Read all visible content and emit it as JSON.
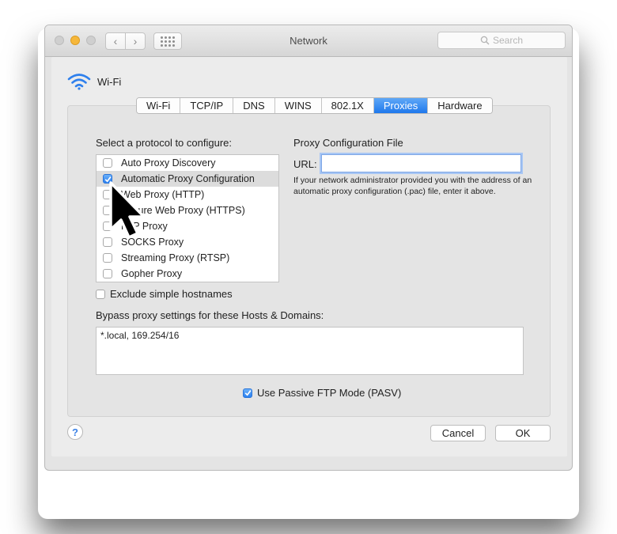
{
  "window": {
    "title": "Network",
    "search_placeholder": "Search"
  },
  "header": {
    "title": "Wi-Fi"
  },
  "tabs": [
    {
      "label": "Wi-Fi",
      "active": false
    },
    {
      "label": "TCP/IP",
      "active": false
    },
    {
      "label": "DNS",
      "active": false
    },
    {
      "label": "WINS",
      "active": false
    },
    {
      "label": "802.1X",
      "active": false
    },
    {
      "label": "Proxies",
      "active": true
    },
    {
      "label": "Hardware",
      "active": false
    }
  ],
  "protocols": {
    "heading": "Select a protocol to configure:",
    "items": [
      {
        "label": "Auto Proxy Discovery",
        "checked": false,
        "selected": false
      },
      {
        "label": "Automatic Proxy Configuration",
        "checked": true,
        "selected": true
      },
      {
        "label": "Web Proxy (HTTP)",
        "checked": false,
        "selected": false
      },
      {
        "label": "Secure Web Proxy (HTTPS)",
        "checked": false,
        "selected": false
      },
      {
        "label": "FTP Proxy",
        "checked": false,
        "selected": false
      },
      {
        "label": "SOCKS Proxy",
        "checked": false,
        "selected": false
      },
      {
        "label": "Streaming Proxy (RTSP)",
        "checked": false,
        "selected": false
      },
      {
        "label": "Gopher Proxy",
        "checked": false,
        "selected": false
      }
    ]
  },
  "config_file": {
    "heading": "Proxy Configuration File",
    "url_label": "URL:",
    "url_value": "",
    "help_text": "If your network administrator provided you with the address of an automatic proxy configuration (.pac) file, enter it above."
  },
  "exclude_simple": {
    "label": "Exclude simple hostnames",
    "checked": false
  },
  "bypass": {
    "label": "Bypass proxy settings for these Hosts & Domains:",
    "value": "*.local, 169.254/16"
  },
  "pasv": {
    "label": "Use Passive FTP Mode (PASV)",
    "checked": true
  },
  "buttons": {
    "help": "?",
    "cancel": "Cancel",
    "ok": "OK"
  },
  "colors": {
    "accent": "#1f78ec",
    "wifi": "#2f80ed"
  }
}
